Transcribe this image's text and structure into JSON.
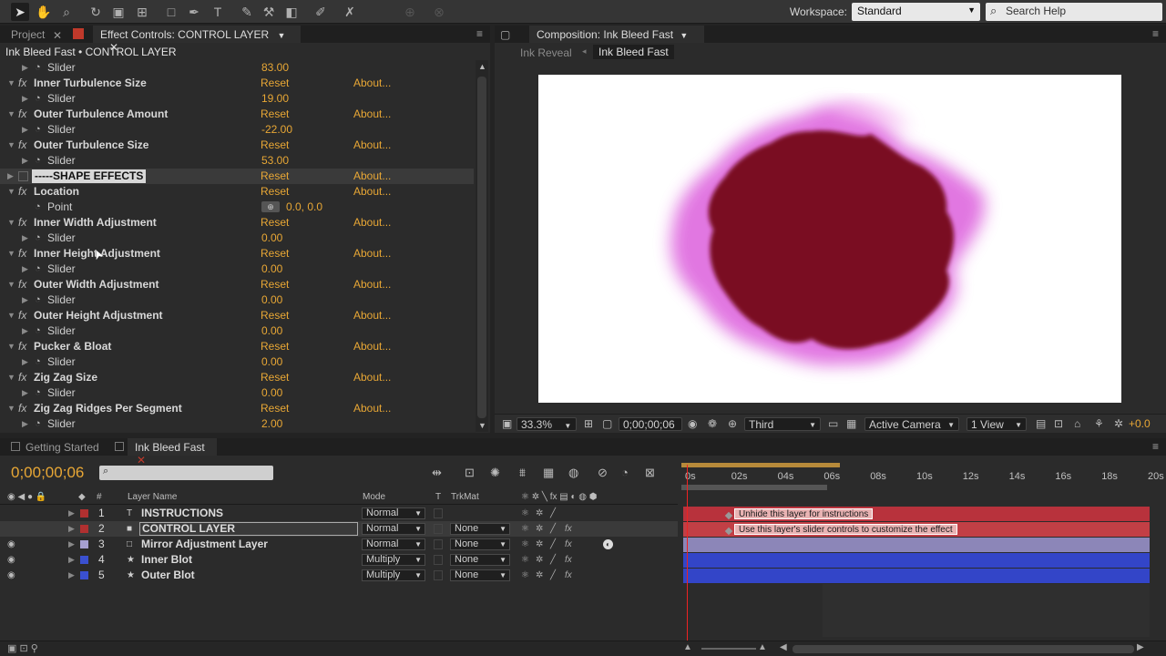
{
  "toolbar": {
    "workspace_label": "Workspace:",
    "workspace_value": "Standard",
    "search_placeholder": "Search Help"
  },
  "left_panel": {
    "tabs": [
      "Project",
      "Effect Controls: CONTROL LAYER"
    ],
    "header": "Ink Bleed Fast • CONTROL LAYER",
    "rows": [
      {
        "type": "sub",
        "label": "Slider",
        "value": "83.00"
      },
      {
        "type": "fx",
        "label": "Inner Turbulence Size",
        "reset": "Reset",
        "about": "About..."
      },
      {
        "type": "sub",
        "label": "Slider",
        "value": "19.00"
      },
      {
        "type": "fx",
        "label": "Outer Turbulence Amount",
        "reset": "Reset",
        "about": "About..."
      },
      {
        "type": "sub",
        "label": "Slider",
        "value": "-22.00"
      },
      {
        "type": "fx",
        "label": "Outer Turbulence Size",
        "reset": "Reset",
        "about": "About..."
      },
      {
        "type": "sub",
        "label": "Slider",
        "value": "53.00"
      },
      {
        "type": "section",
        "label": "-----SHAPE EFFECTS",
        "reset": "Reset",
        "about": "About..."
      },
      {
        "type": "fx",
        "label": "Location",
        "reset": "Reset",
        "about": "About..."
      },
      {
        "type": "point",
        "label": "Point",
        "value": "0.0, 0.0"
      },
      {
        "type": "fx",
        "label": "Inner Width Adjustment",
        "reset": "Reset",
        "about": "About..."
      },
      {
        "type": "sub",
        "label": "Slider",
        "value": "0.00"
      },
      {
        "type": "fx",
        "label": "Inner Height Adjustment",
        "reset": "Reset",
        "about": "About..."
      },
      {
        "type": "sub",
        "label": "Slider",
        "value": "0.00"
      },
      {
        "type": "fx",
        "label": "Outer Width Adjustment",
        "reset": "Reset",
        "about": "About..."
      },
      {
        "type": "sub",
        "label": "Slider",
        "value": "0.00"
      },
      {
        "type": "fx",
        "label": "Outer Height Adjustment",
        "reset": "Reset",
        "about": "About..."
      },
      {
        "type": "sub",
        "label": "Slider",
        "value": "0.00"
      },
      {
        "type": "fx",
        "label": "Pucker & Bloat",
        "reset": "Reset",
        "about": "About..."
      },
      {
        "type": "sub",
        "label": "Slider",
        "value": "0.00"
      },
      {
        "type": "fx",
        "label": "Zig Zag Size",
        "reset": "Reset",
        "about": "About..."
      },
      {
        "type": "sub",
        "label": "Slider",
        "value": "0.00"
      },
      {
        "type": "fx",
        "label": "Zig Zag Ridges Per Segment",
        "reset": "Reset",
        "about": "About..."
      },
      {
        "type": "sub",
        "label": "Slider",
        "value": "2.00"
      }
    ]
  },
  "comp_panel": {
    "tab": "Composition: Ink Bleed Fast",
    "breadcrumbs": [
      "Ink Reveal",
      "Ink Bleed Fast"
    ],
    "zoom": "33.3%",
    "timecode": "0;00;00;06",
    "resolution": "Third",
    "camera": "Active Camera",
    "views": "1 View",
    "exposure": "+0.0"
  },
  "timeline": {
    "tabs": [
      "Getting Started",
      "Ink Bleed Fast"
    ],
    "timecode": "0;00;00;06",
    "columns": {
      "source": "Layer Name",
      "mode": "Mode",
      "t": "T",
      "trkmat": "TrkMat"
    },
    "ruler_ticks": [
      "0s",
      "02s",
      "04s",
      "06s",
      "08s",
      "10s",
      "12s",
      "14s",
      "16s",
      "18s",
      "20s"
    ],
    "layers": [
      {
        "num": "1",
        "name": "INSTRUCTIONS",
        "mode": "Normal",
        "trkmat": "",
        "label_color": "#b03030",
        "icon": "T",
        "note": "Unhide this layer for instructions"
      },
      {
        "num": "2",
        "name": "CONTROL LAYER",
        "mode": "Normal",
        "trkmat": "None",
        "label_color": "#b03030",
        "icon": "■",
        "note": "Use this layer's slider controls to customize the effect"
      },
      {
        "num": "3",
        "name": "Mirror Adjustment Layer",
        "mode": "Normal",
        "trkmat": "None",
        "label_color": "#a6a0d0",
        "icon": "□",
        "note": ""
      },
      {
        "num": "4",
        "name": "Inner Blot",
        "mode": "Multiply",
        "trkmat": "None",
        "label_color": "#3a50d0",
        "icon": "★",
        "note": ""
      },
      {
        "num": "5",
        "name": "Outer Blot",
        "mode": "Multiply",
        "trkmat": "None",
        "label_color": "#3a50d0",
        "icon": "★",
        "note": ""
      }
    ]
  }
}
